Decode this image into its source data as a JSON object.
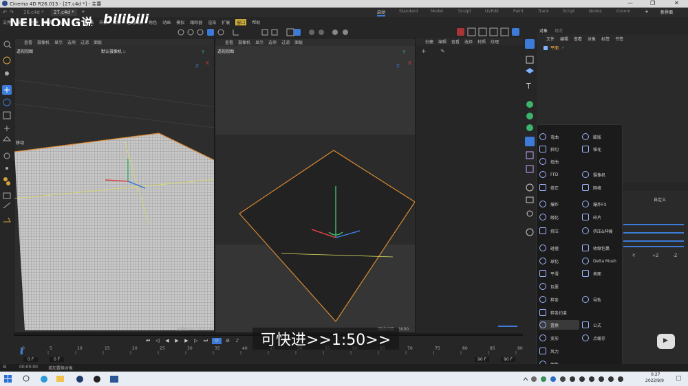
{
  "window": {
    "title": "Cinema 4D R26.013 - [27.c4d *] - 主要"
  },
  "watermark": {
    "text": "NEILHONG说",
    "logo": "bilibili"
  },
  "doc_tabs": [
    "26.c4d *",
    "27.c4d *"
  ],
  "modes": [
    "启动",
    "Standard",
    "Model",
    "Sculpt",
    "UVEdit",
    "Paint",
    "Track",
    "Script",
    "Nodes",
    "Groom"
  ],
  "new_interface_label": "新界面",
  "menu_left": [
    "文件",
    "编辑",
    "创建",
    "模式",
    "选择",
    "工具",
    "网格",
    "样条",
    "体积",
    "运动图形",
    "角色",
    "动画",
    "模拟",
    "跟踪器",
    "渲染",
    "扩展",
    "窗口",
    "帮助"
  ],
  "viewport_left": {
    "menu": [
      "查看",
      "摄像机",
      "显示",
      "选项",
      "过滤",
      "面板"
    ],
    "label": "透视视图",
    "camera": "默认摄像机 ::",
    "move_label": "移动",
    "grid_info": "网格间距 : 500 cm"
  },
  "viewport_right": {
    "menu": [
      "查看",
      "摄像机",
      "显示",
      "选项",
      "过滤",
      "面板"
    ],
    "label": "透视视图",
    "grid_info": "网格间距 : 5000 cm"
  },
  "material_panel": {
    "menu": [
      "创建",
      "编辑",
      "查看",
      "选择",
      "材质",
      "纹理"
    ]
  },
  "objects_panel": {
    "tabs": [
      "对象",
      "场次"
    ],
    "menu": [
      "文件",
      "编辑",
      "查看",
      "对象",
      "标签",
      "书签"
    ],
    "object_name": "平面"
  },
  "attributes_panel": {
    "custom_label": "自定义",
    "axes": [
      "-Y",
      "+Z",
      "-Z"
    ]
  },
  "deformers": {
    "left": [
      "弯曲",
      "斜切",
      "扭曲",
      "FFD",
      "修正",
      "爆炸",
      "融化",
      "挤压",
      "碰撞",
      "球化",
      "平滑",
      "包裹",
      "样条",
      "样条约束",
      "置换",
      "变形",
      "风力",
      "倒角"
    ],
    "right": [
      "膨胀",
      "锥化",
      "摄像机",
      "网格",
      "爆炸FX",
      "碎片",
      "挤压&伸展",
      "收缩包裹",
      "Delta Mush",
      "表面",
      "导轨",
      "公式",
      "点缓存"
    ],
    "selected": "置换"
  },
  "timeline": {
    "ticks": [
      "0",
      "5",
      "10",
      "15",
      "20",
      "25",
      "30",
      "35",
      "40",
      "45",
      "50",
      "55",
      "60",
      "65",
      "70",
      "75",
      "80",
      "85",
      "90"
    ],
    "start_frame": "0 F",
    "current_frame": "0 F",
    "end_frame": "90 F",
    "end_frame2": "90 F"
  },
  "subtitle": "可快进>>1:50>>",
  "status": {
    "time": "00:00:00",
    "message": "增加置换对象"
  },
  "taskbar": {
    "clock_time": "0:27",
    "clock_date": "2022/8/9"
  }
}
